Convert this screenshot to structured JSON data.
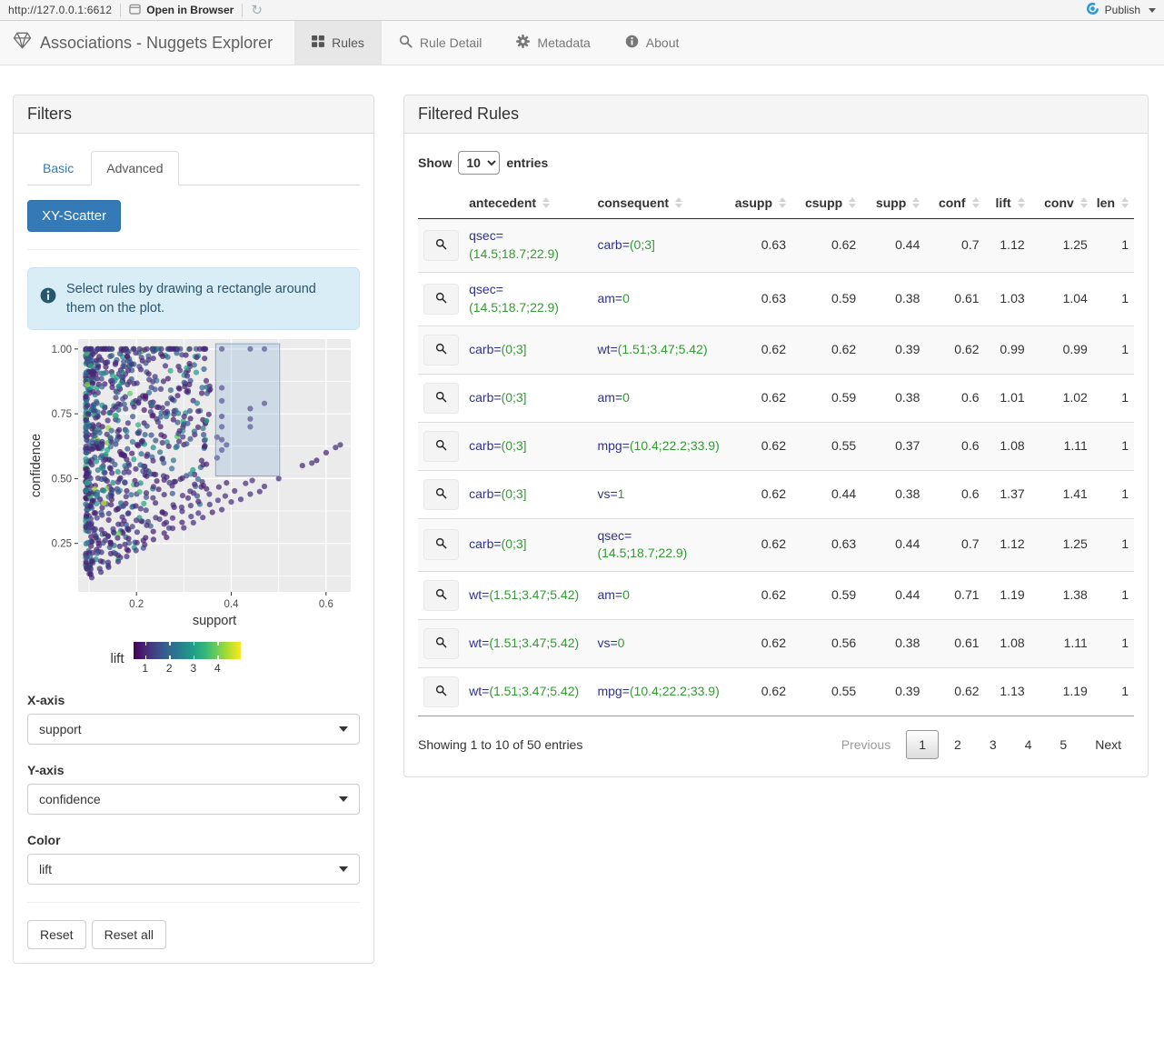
{
  "viewer_toolbar": {
    "url": "http://127.0.0.1:6612",
    "open_in_browser_label": "Open in Browser",
    "publish_label": "Publish",
    "publish_accent_color": "#2d9ad8"
  },
  "navbar": {
    "brand": "Associations - Nuggets Explorer",
    "tabs": [
      {
        "label": "Rules",
        "icon": "table-icon",
        "active": true
      },
      {
        "label": "Rule Detail",
        "icon": "search-icon",
        "active": false
      },
      {
        "label": "Metadata",
        "icon": "gear-icon",
        "active": false
      },
      {
        "label": "About",
        "icon": "info-icon",
        "active": false
      }
    ]
  },
  "filters": {
    "title": "Filters",
    "tabs": [
      {
        "label": "Basic",
        "active": false
      },
      {
        "label": "Advanced",
        "active": true
      }
    ],
    "scatter_button_label": "XY-Scatter",
    "info_alert": "Select rules by drawing a rectangle around them on the plot.",
    "controls": [
      {
        "label": "X-axis",
        "value": "support"
      },
      {
        "label": "Y-axis",
        "value": "confidence"
      },
      {
        "label": "Color",
        "value": "lift"
      }
    ],
    "reset_label": "Reset",
    "reset_all_label": "Reset all"
  },
  "chart_data": {
    "type": "scatter",
    "xlabel": "support",
    "ylabel": "confidence",
    "xlim": [
      0.077,
      0.652
    ],
    "ylim": [
      0.063,
      1.038
    ],
    "x_ticks": [
      0.2,
      0.4,
      0.6
    ],
    "x_tick_labels": [
      "0.2",
      "0.4",
      "0.6"
    ],
    "y_ticks": [
      0.25,
      0.5,
      0.75,
      1.0
    ],
    "y_tick_labels": [
      "0.25",
      "0.50",
      "0.75",
      "1.00"
    ],
    "x_minor": [
      0.1,
      0.3,
      0.5
    ],
    "y_minor": [
      0.125,
      0.375,
      0.625,
      0.875
    ],
    "grid": true,
    "panel_bg": "#ebebeb",
    "point_radius": 3.1,
    "point_opacity": 0.72,
    "color_scale": {
      "title": "lift",
      "palette": "viridis",
      "ticks": [
        "1",
        "2",
        "3",
        "4"
      ],
      "tick_values": [
        1,
        2,
        3,
        4
      ],
      "domain": [
        0.5,
        4.95
      ]
    },
    "brush": {
      "x": [
        0.367,
        0.502
      ],
      "y": [
        0.51,
        1.02
      ]
    },
    "generator": {
      "seed": 42,
      "cloud_n": 780,
      "cloud_supp_min": 0.093,
      "cloud_supp_span": 0.263,
      "top_row_n": 58,
      "chains": {
        "slopes": [
          1.12,
          1.25,
          1.45,
          1.7,
          2.0,
          2.4
        ],
        "max_supp": [
          0.45,
          0.4,
          0.33,
          0.3,
          0.27,
          0.24
        ],
        "step": 0.019
      }
    },
    "outlier_points": [
      [
        0.38,
        1.0
      ],
      [
        0.44,
        1.0
      ],
      [
        0.47,
        1.0
      ],
      [
        0.38,
        0.85
      ],
      [
        0.38,
        0.8
      ],
      [
        0.44,
        0.77
      ],
      [
        0.47,
        0.79
      ],
      [
        0.38,
        0.74
      ],
      [
        0.44,
        0.73
      ],
      [
        0.44,
        0.7
      ],
      [
        0.38,
        0.7
      ],
      [
        0.37,
        0.66
      ],
      [
        0.38,
        0.65
      ],
      [
        0.39,
        0.63
      ],
      [
        0.38,
        0.61
      ],
      [
        0.37,
        0.58
      ],
      [
        0.63,
        0.63
      ],
      [
        0.62,
        0.62
      ],
      [
        0.6,
        0.6
      ],
      [
        0.58,
        0.57
      ],
      [
        0.57,
        0.56
      ],
      [
        0.55,
        0.55
      ],
      [
        0.5,
        0.5
      ],
      [
        0.47,
        0.47
      ],
      [
        0.46,
        0.45
      ],
      [
        0.44,
        0.44
      ],
      [
        0.42,
        0.42
      ],
      [
        0.4,
        0.41
      ],
      [
        0.38,
        0.38
      ],
      [
        0.36,
        0.37
      ],
      [
        0.34,
        0.35
      ],
      [
        0.32,
        0.33
      ],
      [
        0.3,
        0.31
      ]
    ]
  },
  "table": {
    "title": "Filtered Rules",
    "show_label": "Show",
    "entries_label": "entries",
    "page_length": "10",
    "columns": [
      "antecedent",
      "consequent",
      "asupp",
      "csupp",
      "supp",
      "conf",
      "lift",
      "conv",
      "len"
    ],
    "rows": [
      {
        "antecedent": {
          "name": "qsec=",
          "value": "(14.5;18.7;22.9)"
        },
        "consequent": {
          "name": "carb=",
          "value": "(0;3]"
        },
        "asupp": "0.63",
        "csupp": "0.62",
        "supp": "0.44",
        "conf": "0.7",
        "lift": "1.12",
        "conv": "1.25",
        "len": "1"
      },
      {
        "antecedent": {
          "name": "qsec=",
          "value": "(14.5;18.7;22.9)"
        },
        "consequent": {
          "name": "am=",
          "value": "0"
        },
        "asupp": "0.63",
        "csupp": "0.59",
        "supp": "0.38",
        "conf": "0.61",
        "lift": "1.03",
        "conv": "1.04",
        "len": "1"
      },
      {
        "antecedent": {
          "name": "carb=",
          "value": "(0;3]"
        },
        "consequent": {
          "name": "wt=",
          "value": "(1.51;3.47;5.42)"
        },
        "asupp": "0.62",
        "csupp": "0.62",
        "supp": "0.39",
        "conf": "0.62",
        "lift": "0.99",
        "conv": "0.99",
        "len": "1"
      },
      {
        "antecedent": {
          "name": "carb=",
          "value": "(0;3]"
        },
        "consequent": {
          "name": "am=",
          "value": "0"
        },
        "asupp": "0.62",
        "csupp": "0.59",
        "supp": "0.38",
        "conf": "0.6",
        "lift": "1.01",
        "conv": "1.02",
        "len": "1"
      },
      {
        "antecedent": {
          "name": "carb=",
          "value": "(0;3]"
        },
        "consequent": {
          "name": "mpg=",
          "value": "(10.4;22.2;33.9)"
        },
        "asupp": "0.62",
        "csupp": "0.55",
        "supp": "0.37",
        "conf": "0.6",
        "lift": "1.08",
        "conv": "1.11",
        "len": "1"
      },
      {
        "antecedent": {
          "name": "carb=",
          "value": "(0;3]"
        },
        "consequent": {
          "name": "vs=",
          "value": "1"
        },
        "asupp": "0.62",
        "csupp": "0.44",
        "supp": "0.38",
        "conf": "0.6",
        "lift": "1.37",
        "conv": "1.41",
        "len": "1"
      },
      {
        "antecedent": {
          "name": "carb=",
          "value": "(0;3]"
        },
        "consequent": {
          "name": "qsec=",
          "value": "(14.5;18.7;22.9)"
        },
        "asupp": "0.62",
        "csupp": "0.63",
        "supp": "0.44",
        "conf": "0.7",
        "lift": "1.12",
        "conv": "1.25",
        "len": "1"
      },
      {
        "antecedent": {
          "name": "wt=",
          "value": "(1.51;3.47;5.42)"
        },
        "consequent": {
          "name": "am=",
          "value": "0"
        },
        "asupp": "0.62",
        "csupp": "0.59",
        "supp": "0.44",
        "conf": "0.71",
        "lift": "1.19",
        "conv": "1.38",
        "len": "1"
      },
      {
        "antecedent": {
          "name": "wt=",
          "value": "(1.51;3.47;5.42)"
        },
        "consequent": {
          "name": "vs=",
          "value": "0"
        },
        "asupp": "0.62",
        "csupp": "0.56",
        "supp": "0.38",
        "conf": "0.61",
        "lift": "1.08",
        "conv": "1.11",
        "len": "1"
      },
      {
        "antecedent": {
          "name": "wt=",
          "value": "(1.51;3.47;5.42)"
        },
        "consequent": {
          "name": "mpg=",
          "value": "(10.4;22.2;33.9)"
        },
        "asupp": "0.62",
        "csupp": "0.55",
        "supp": "0.39",
        "conf": "0.62",
        "lift": "1.13",
        "conv": "1.19",
        "len": "1"
      }
    ],
    "info": "Showing 1 to 10 of 50 entries",
    "pagination": {
      "previous": "Previous",
      "pages": [
        "1",
        "2",
        "3",
        "4",
        "5"
      ],
      "current": "1",
      "next": "Next"
    }
  }
}
